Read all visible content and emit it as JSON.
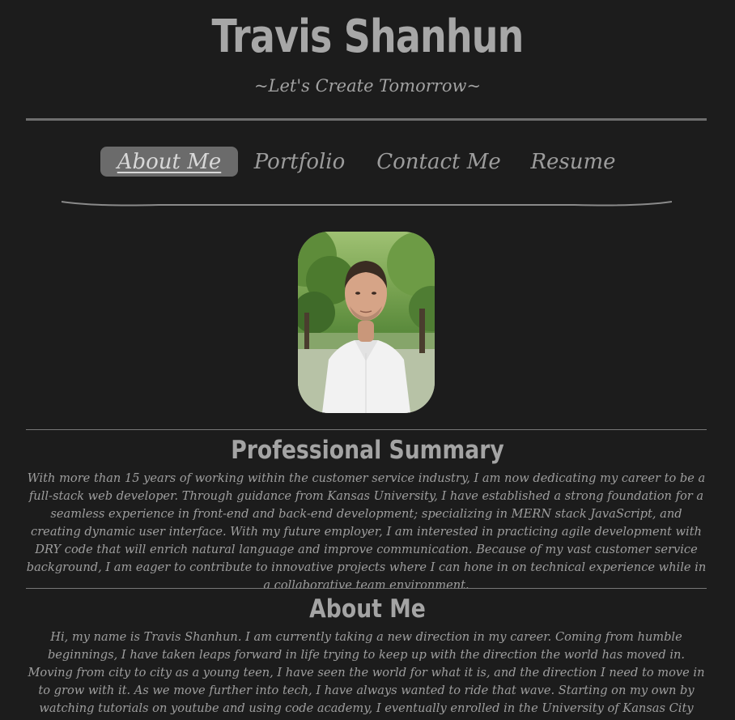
{
  "header": {
    "title": "Travis Shanhun",
    "tagline": "~Let's Create Tomorrow~"
  },
  "nav": {
    "items": [
      {
        "label": "About Me",
        "active": true
      },
      {
        "label": "Portfolio",
        "active": false
      },
      {
        "label": "Contact Me",
        "active": false
      },
      {
        "label": "Resume",
        "active": false
      }
    ]
  },
  "profile": {
    "image": "profile-photo"
  },
  "summary": {
    "heading": "Professional Summary",
    "text": "With more than 15 years of working within the customer service industry, I am now dedicating my career to be a full-stack web developer. Through guidance from Kansas University, I have established a strong foundation for a seamless experience in front-end and back-end development; specializing in MERN stack JavaScript, and creating dynamic user interface. With my future employer, I am interested in practicing agile development with DRY code that will enrich natural language and improve communication. Because of my vast customer service background, I am eager to contribute to innovative projects where I can hone in on technical experience while in a collaborative team environment."
  },
  "about": {
    "heading": "About Me",
    "text": "Hi, my name is Travis Shanhun. I am currently taking a new direction in my career. Coming from humble beginnings, I have taken leaps forward in life trying to keep up with the direction the world has moved in. Moving from city to city as a young teen, I have seen the world for what it is, and the direction I need to move in to grow with it. As we move further into tech, I have always wanted to ride that wave. Starting on my own by watching tutorials on youtube and using code academy, I eventually enrolled in the University of Kansas City (KU) online coding bootcamp; to give more structure, resources, and instruction to my learning. As a"
  },
  "colors": {
    "background": "#1c1c1c",
    "text": "#9e9e9e",
    "nav_active_bg": "#6b6b6b"
  }
}
